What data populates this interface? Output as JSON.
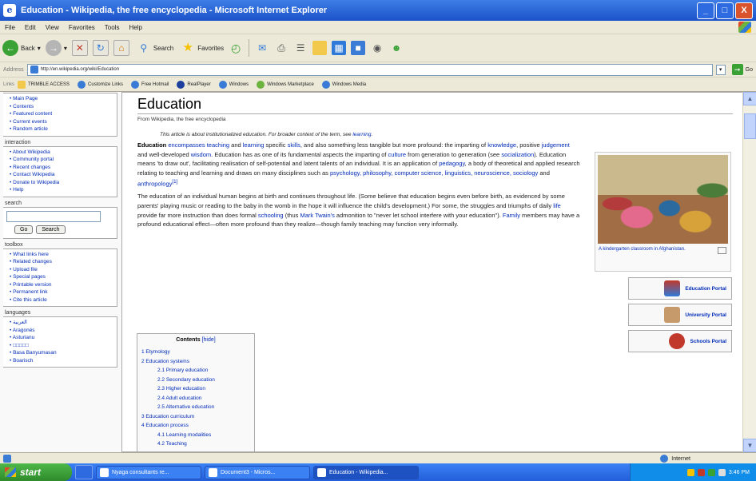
{
  "window": {
    "title": "Education - Wikipedia, the free encyclopedia - Microsoft Internet Explorer",
    "controls": [
      "_",
      "□",
      "X"
    ]
  },
  "menu": [
    "File",
    "Edit",
    "View",
    "Favorites",
    "Tools",
    "Help"
  ],
  "toolbar": {
    "back": "Back",
    "search": "Search",
    "favorites": "Favorites"
  },
  "address": {
    "label": "Address",
    "url": "http://en.wikipedia.org/wiki/Education",
    "go": "Go"
  },
  "links": {
    "label": "Links",
    "items": [
      "TRIMBLE ACCESS",
      "Customize Links",
      "Free Hotmail",
      "RealPlayer",
      "Windows",
      "Windows Marketplace",
      "Windows Media"
    ]
  },
  "sidebar": {
    "navigation": [
      "Main Page",
      "Contents",
      "Featured content",
      "Current events",
      "Random article"
    ],
    "interaction_title": "interaction",
    "interaction": [
      "About Wikipedia",
      "Community portal",
      "Recent changes",
      "Contact Wikipedia",
      "Donate to Wikipedia",
      "Help"
    ],
    "search_title": "search",
    "go_button": "Go",
    "search_button": "Search",
    "toolbox_title": "toolbox",
    "toolbox": [
      "What links here",
      "Related changes",
      "Upload file",
      "Special pages",
      "Printable version",
      "Permanent link",
      "Cite this article"
    ],
    "languages_title": "languages",
    "languages": [
      "العربية",
      "Aragonés",
      "Asturianu",
      "□□□□□",
      "Basa Banyumasan",
      "Boarisch"
    ]
  },
  "article": {
    "title": "Education",
    "from": "From Wikipedia, the free encyclopedia",
    "hatnote_pre": "This article is about institutionalized education. For broader context of the term, see ",
    "hatnote_link": "learning",
    "hatnote_post": ".",
    "para1": {
      "bold": "Education",
      "t1": " ",
      "l1": "encompasses teaching",
      "t2": " and ",
      "l2": "learning",
      "t3": " specific ",
      "l3": "skills",
      "t4": ", and also something less tangible but more profound: the imparting of ",
      "l4": "knowledge",
      "t5": ", positive ",
      "l5": "judgement",
      "t6": " and well-developed ",
      "l6": "wisdom",
      "t7": ". Education has as one of its fundamental aspects the imparting of ",
      "l7": "culture",
      "t8": " from generation to generation (see ",
      "l8": "socialization",
      "t9": "). Education means 'to draw out', facilitating realisation of self-potential and latent talents of an individual. It is an application of ",
      "l9": "pedagogy",
      "t10": ", a body of theoretical and applied research relating to teaching and learning and draws on many disciplines such as ",
      "l10": "psychology, philosophy, computer science, linguistics, neuroscience, sociology",
      "t11": " and ",
      "l11": "anthropology",
      "ref": "[1]"
    },
    "para2": {
      "t1": "The education of an individual human begins at birth and continues throughout life. (Some believe that education begins even before birth, as evidenced by some parents' playing music or reading to the baby in the womb in the hope it will influence the child's development.) For some, the struggles and triumphs of daily ",
      "l1": "life",
      "t2": " provide far more instruction than does formal ",
      "l2": "schooling",
      "t3": " (thus ",
      "l3": "Mark Twain's",
      "t4": " admonition to \"never let school interfere with your education\"). ",
      "l4": "Family",
      "t5": " members may have a profound educational effect—often more profound than they realize—though family teaching may function very informally."
    },
    "image_caption": "A kindergarten classroom in Afghanistan.",
    "portals": [
      "Education Portal",
      "University Portal",
      "Schools Portal"
    ],
    "toc": {
      "title": "Contents",
      "hide": "[hide]",
      "items": [
        {
          "label": "1 Etymology",
          "sub": false
        },
        {
          "label": "2 Education systems",
          "sub": false
        },
        {
          "label": "2.1 Primary education",
          "sub": true
        },
        {
          "label": "2.2 Secondary education",
          "sub": true
        },
        {
          "label": "2.3 Higher education",
          "sub": true
        },
        {
          "label": "2.4 Adult education",
          "sub": true
        },
        {
          "label": "2.5 Alternative education",
          "sub": true
        },
        {
          "label": "3 Education curriculum",
          "sub": false
        },
        {
          "label": "4 Education process",
          "sub": false
        },
        {
          "label": "4.1 Learning modalities",
          "sub": true
        },
        {
          "label": "4.2 Teaching",
          "sub": true
        }
      ]
    }
  },
  "status": {
    "zone": "Internet"
  },
  "taskbar": {
    "start": "start",
    "tasks": [
      "Nyaga consultants re...",
      "Document3 - Micros...",
      "Education - Wikipedia..."
    ],
    "clock": "3:46 PM"
  },
  "colors": {
    "link": "#002bb8",
    "titlebar": "#245edb",
    "chrome": "#ece9d8"
  }
}
